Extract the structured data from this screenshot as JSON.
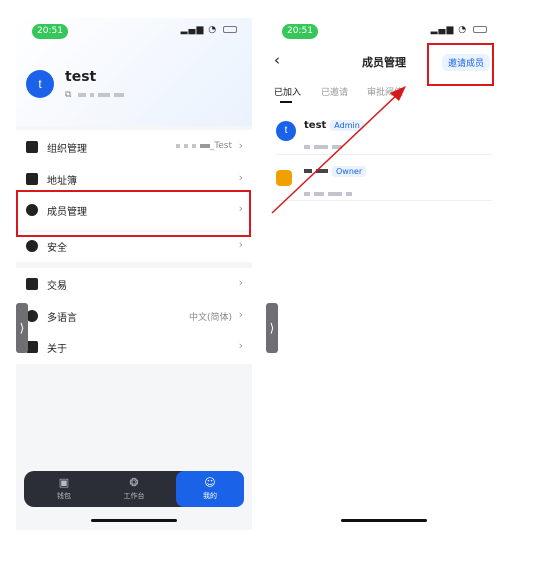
{
  "left_screen": {
    "status": {
      "time": "20:51",
      "signal": "▂▄▆",
      "wifi": "◔"
    },
    "profile": {
      "avatar_letter": "t",
      "username": "test",
      "account_icon": "⧉"
    },
    "menu_group1": [
      {
        "icon": "org-icon",
        "label": "组织管理",
        "value": "_Test"
      },
      {
        "icon": "address-book-icon",
        "label": "地址簿",
        "value": ""
      },
      {
        "icon": "member-icon",
        "label": "成员管理",
        "value": ""
      }
    ],
    "menu_group2": [
      {
        "icon": "security-icon",
        "label": "安全",
        "value": ""
      }
    ],
    "menu_group3": [
      {
        "icon": "transaction-icon",
        "label": "交易",
        "value": ""
      },
      {
        "icon": "globe-icon",
        "label": "多语言",
        "value": "中文(简体)"
      },
      {
        "icon": "home-icon",
        "label": "关于",
        "value": ""
      }
    ],
    "chevron": "›",
    "tabbar": [
      {
        "label": "钱包",
        "icon": "▣"
      },
      {
        "label": "工作台",
        "icon": "❂"
      },
      {
        "label": "我的",
        "icon": "☺"
      }
    ],
    "side_handle": "⟩"
  },
  "right_screen": {
    "status": {
      "time": "20:51",
      "signal": "▂▄▆",
      "wifi": "◔"
    },
    "back": "‹",
    "title": "成员管理",
    "invite_button": "邀请成员",
    "tabs": [
      "已加入",
      "已邀请",
      "审批阈值"
    ],
    "members": [
      {
        "avatar_letter": "t",
        "name": "test",
        "role": "Admin"
      },
      {
        "name": "",
        "role": "Owner"
      }
    ],
    "side_handle": "⟩"
  },
  "colors": {
    "accent": "#1a63e8",
    "annotation": "#d7191c",
    "status_green": "#35c759",
    "tabbar_bg": "#2b2e36"
  }
}
